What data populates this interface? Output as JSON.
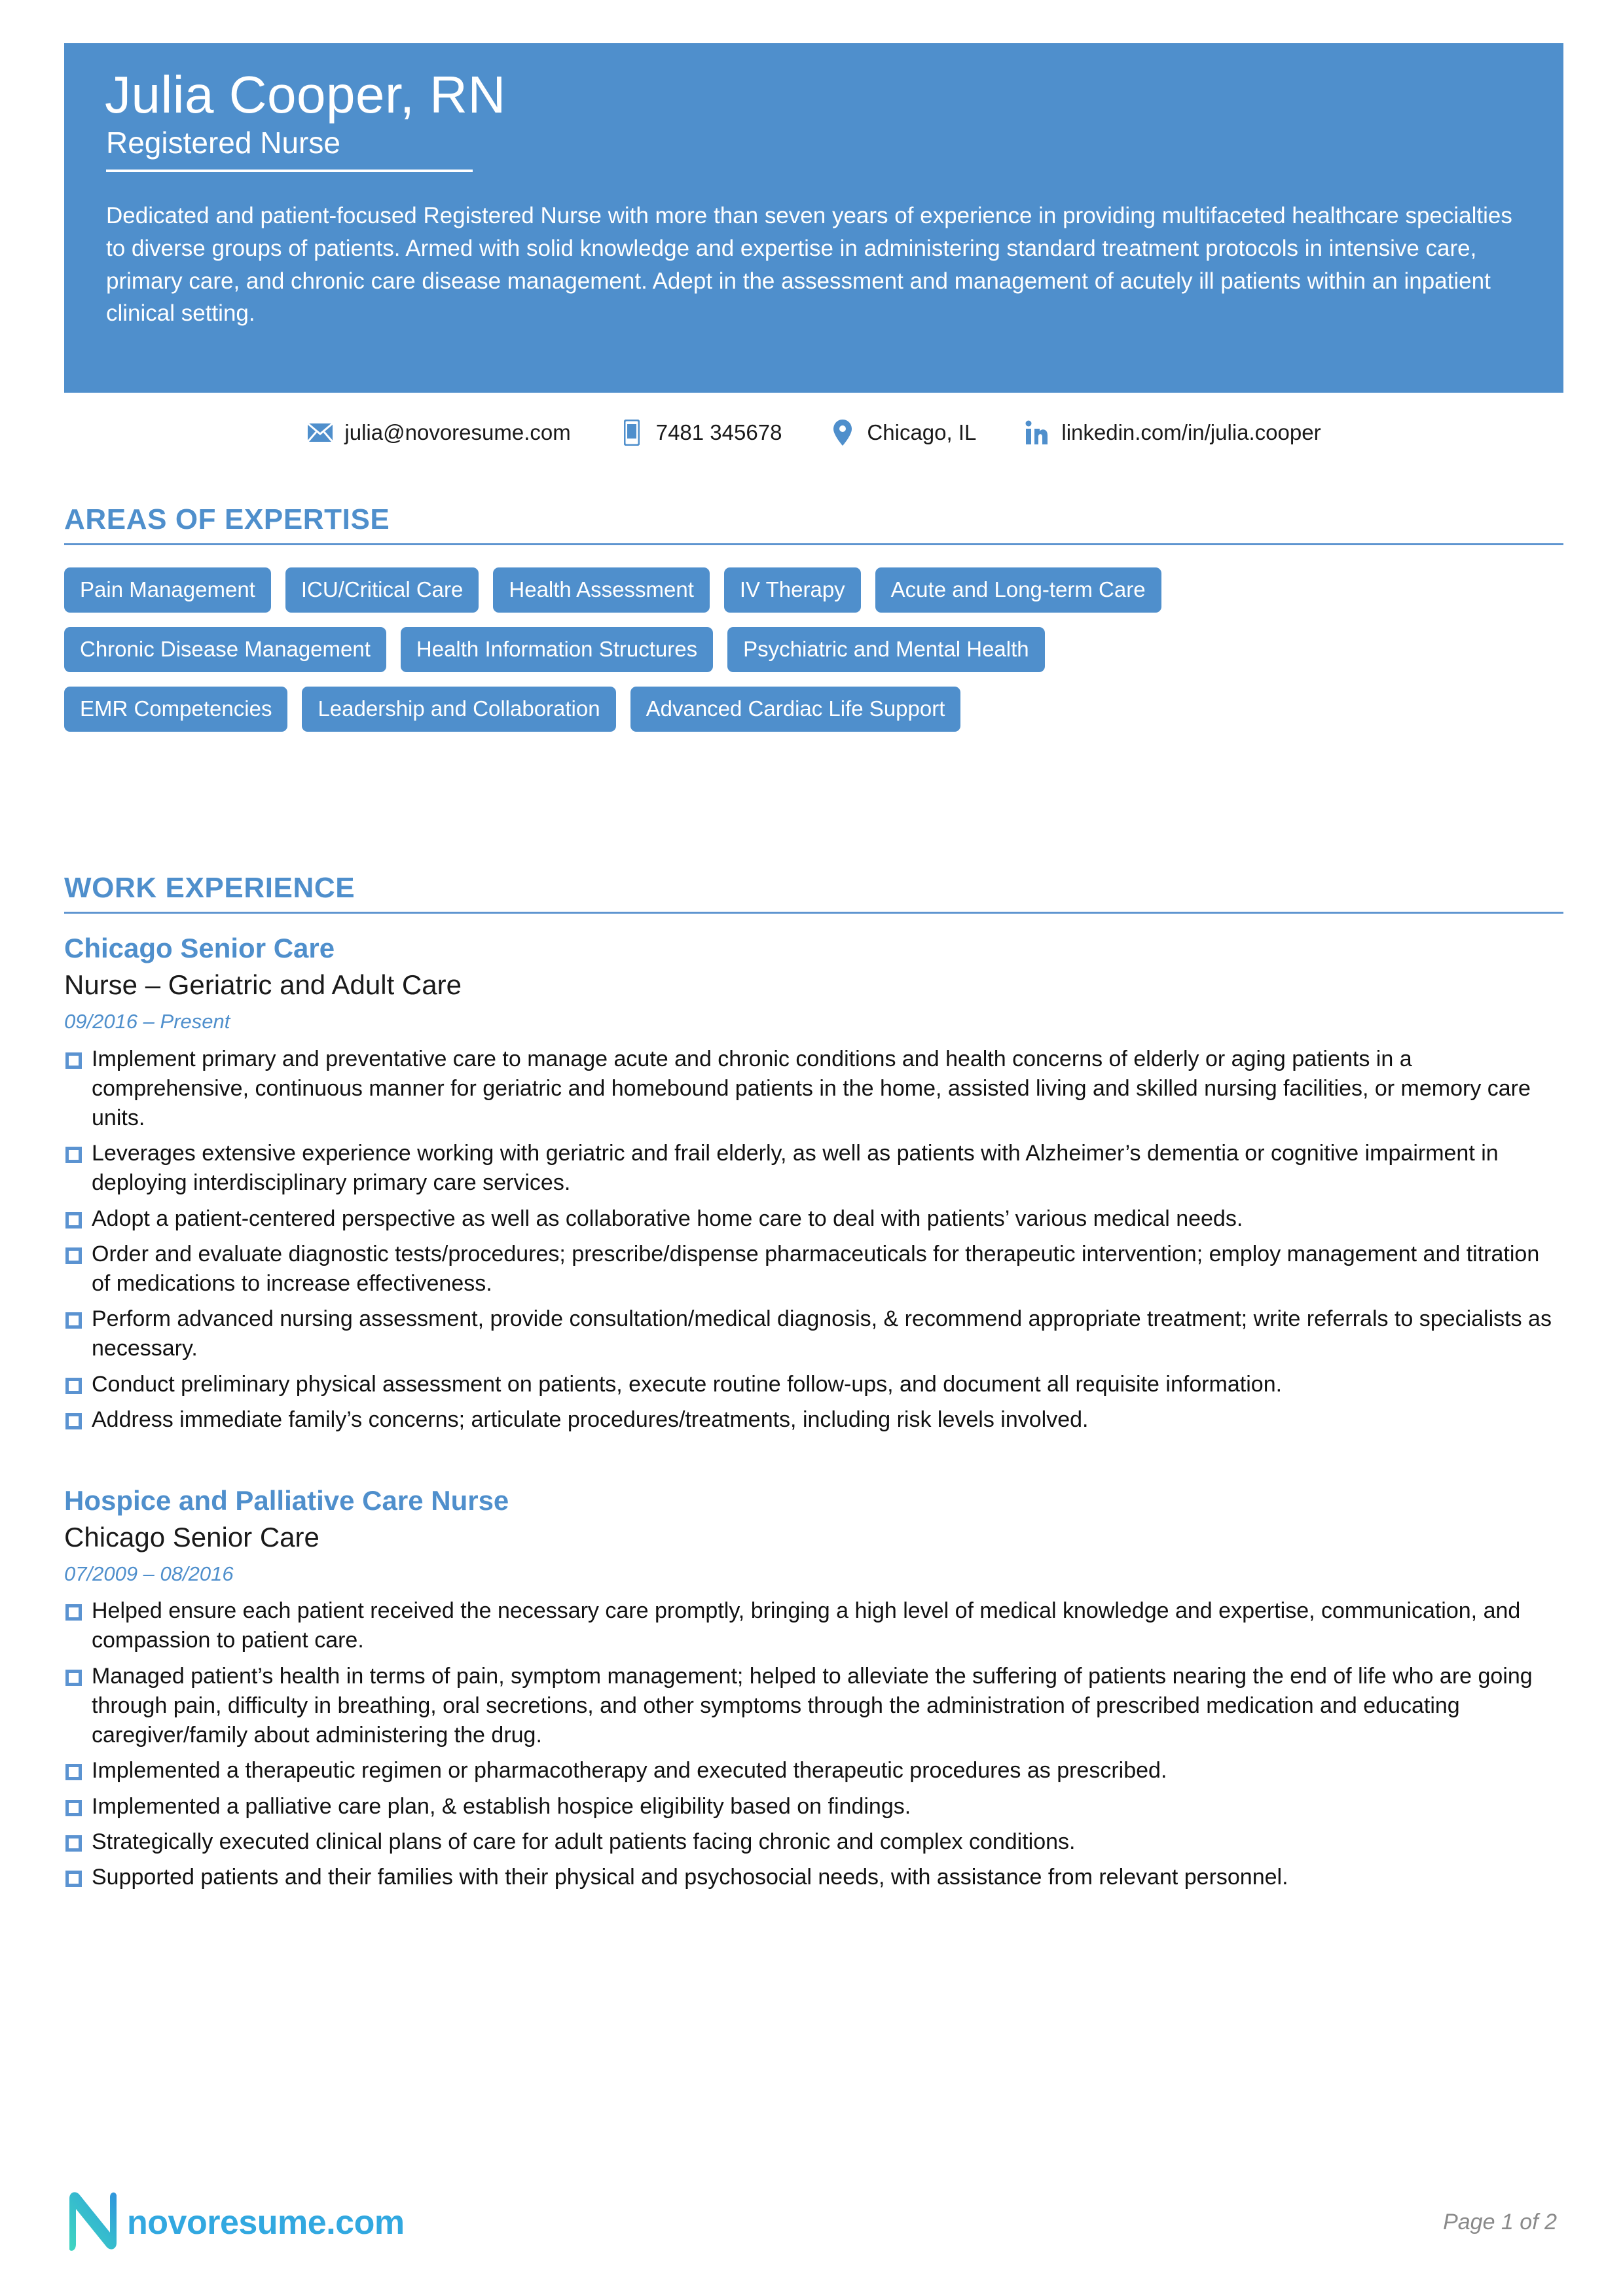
{
  "header": {
    "name": "Julia Cooper, RN",
    "title": "Registered Nurse",
    "summary": "Dedicated and patient-focused Registered Nurse with more than seven years of experience in providing multifaceted healthcare specialties to diverse groups of patients. Armed with solid knowledge and expertise in administering standard treatment protocols in intensive care, primary care, and chronic care disease management. Adept in the assessment and management of acutely ill patients within an inpatient clinical setting.",
    "band_color": "#4f8fcc"
  },
  "contact": {
    "email": "julia@novoresume.com",
    "phone": "7481 345678",
    "location": "Chicago, IL",
    "linkedin": "linkedin.com/in/julia.cooper",
    "icons": {
      "email": "envelope-icon",
      "phone": "mobile-phone-icon",
      "location": "map-pin-icon",
      "linkedin": "linkedin-icon"
    }
  },
  "expertise": {
    "heading": "AREAS OF EXPERTISE",
    "rows": [
      [
        "Pain Management",
        "ICU/Critical Care",
        "Health Assessment",
        "IV Therapy",
        "Acute and Long-term Care"
      ],
      [
        "Chronic Disease Management",
        "Health Information Structures",
        "Psychiatric and Mental Health"
      ],
      [
        "EMR Competencies",
        "Leadership and Collaboration",
        "Advanced Cardiac Life Support"
      ]
    ]
  },
  "experience": {
    "heading": "WORK EXPERIENCE",
    "jobs": [
      {
        "line1": "Chicago Senior Care",
        "line2": "Nurse – Geriatric and Adult Care",
        "dates": "09/2016 – Present",
        "bullets": [
          "Implement primary and preventative care to manage acute and chronic conditions and health concerns of elderly or aging patients in a comprehensive, continuous manner for geriatric and homebound patients in the home, assisted living and skilled nursing facilities, or memory care units.",
          "Leverages extensive experience working with geriatric and frail elderly, as well as patients with Alzheimer’s dementia or cognitive impairment in deploying interdisciplinary primary care services.",
          "Adopt a patient-centered perspective as well as collaborative home care to deal with patients’ various medical needs.",
          "Order and evaluate diagnostic tests/procedures; prescribe/dispense pharmaceuticals for therapeutic intervention; employ management and titration of medications to increase effectiveness.",
          "Perform advanced nursing assessment, provide consultation/medical diagnosis, & recommend appropriate treatment; write referrals to specialists as necessary.",
          "Conduct preliminary physical assessment on patients, execute routine follow-ups, and document all requisite information.",
          "Address immediate family’s concerns; articulate procedures/treatments, including risk levels involved."
        ]
      },
      {
        "line1": "Hospice and Palliative Care Nurse",
        "line2": "Chicago Senior Care",
        "dates": "07/2009 – 08/2016",
        "bullets": [
          "Helped ensure each patient received the necessary care promptly, bringing a high level of medical knowledge and expertise, communication, and compassion to patient care.",
          "Managed patient’s health in terms of pain, symptom management; helped to alleviate the suffering of patients nearing the end of life who are going through pain, difficulty in breathing, oral secretions, and other symptoms through the administration of prescribed medication and educating caregiver/family about administering the drug.",
          "Implemented a therapeutic regimen or pharmacotherapy and executed therapeutic procedures as prescribed.",
          "Implemented a palliative care plan, & establish hospice eligibility based on findings.",
          "Strategically executed clinical plans of care for adult patients facing chronic and complex conditions.",
          "Supported patients and their families with their physical and psychosocial needs, with assistance from relevant personnel."
        ]
      }
    ]
  },
  "footer": {
    "logo_text": "novoresume.com",
    "logo_icon": "novoresume-n-logo",
    "page_label": "Page 1 of 2"
  }
}
